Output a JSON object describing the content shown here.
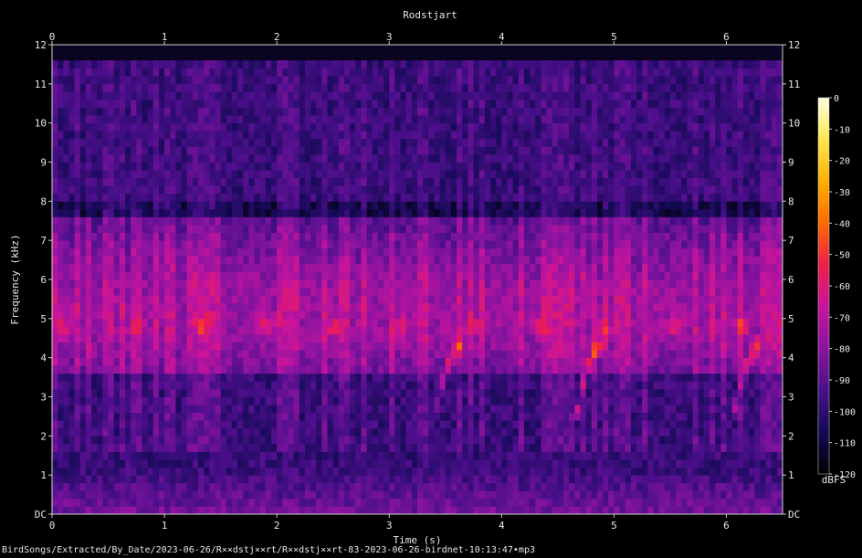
{
  "chart_data": {
    "type": "heatmap",
    "title": "Rodstjart",
    "xlabel": "Time (s)",
    "ylabel": "Frequency (kHz)",
    "xlim": [
      0,
      6.5
    ],
    "ylim": [
      0,
      12
    ],
    "x_ticks": [
      "0",
      "1",
      "2",
      "3",
      "4",
      "5",
      "6"
    ],
    "y_ticks": [
      "DC",
      "1",
      "2",
      "3",
      "4",
      "5",
      "6",
      "7",
      "8",
      "9",
      "10",
      "11",
      "12"
    ],
    "colorbar": {
      "unit": "dBFS",
      "range": [
        -120,
        0
      ],
      "ticks": [
        "0",
        "-10",
        "-20",
        "-30",
        "-40",
        "-50",
        "-60",
        "-70",
        "-80",
        "-90",
        "-100",
        "-110",
        "-120"
      ],
      "colors": [
        "#000000",
        "#140a55",
        "#4a0f8a",
        "#8a14a0",
        "#c8149c",
        "#f01e4a",
        "#ff6a00",
        "#ffb000",
        "#ffe650",
        "#ffffe0"
      ]
    },
    "background_level_db": -105,
    "max_frequency_khz": 11.6,
    "features": {
      "strong_band_khz": [
        3.5,
        7.5
      ],
      "spectral_gap_khz": 7.8,
      "peak_tone_khz": 4.8,
      "peak_tone_times_s": [
        0.1,
        0.75,
        1.35,
        1.9,
        2.5,
        3.1,
        3.75,
        4.35,
        4.9,
        5.55,
        6.15
      ],
      "rising_calls": [
        {
          "t_start": 3.45,
          "t_end": 3.6,
          "f_start_khz": 2.8,
          "f_end_khz": 4.3
        },
        {
          "t_start": 4.7,
          "t_end": 4.85,
          "f_start_khz": 2.7,
          "f_end_khz": 4.3
        },
        {
          "t_start": 6.1,
          "t_end": 6.27,
          "f_start_khz": 2.8,
          "f_end_khz": 4.3
        }
      ]
    }
  },
  "footer": {
    "source_path": "BirdSongs/Extracted/By_Date/2023-06-26/R××dstj××rt/R××dstj××rt-83-2023-06-26-birdnet-10:13:47•mp3"
  }
}
